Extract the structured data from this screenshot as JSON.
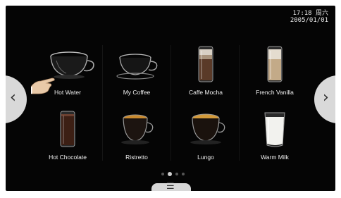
{
  "status": {
    "time": "17:18 周六",
    "date": "2005/01/01"
  },
  "drinks": [
    {
      "label": "Hot Water",
      "icon": "hot-water-cup-icon"
    },
    {
      "label": "My Coffee",
      "icon": "my-coffee-cup-icon"
    },
    {
      "label": "Caffe Mocha",
      "icon": "caffe-mocha-glass-icon"
    },
    {
      "label": "French Vanilla",
      "icon": "french-vanilla-glass-icon"
    },
    {
      "label": "Hot Chocolate",
      "icon": "hot-chocolate-glass-icon"
    },
    {
      "label": "Ristretto",
      "icon": "ristretto-cup-icon"
    },
    {
      "label": "Lungo",
      "icon": "lungo-cup-icon"
    },
    {
      "label": "Warm Milk",
      "icon": "warm-milk-glass-icon"
    }
  ],
  "nav": {
    "prev_icon": "chevron-left-icon",
    "next_icon": "chevron-right-icon",
    "menu_icon": "hamburger-menu-icon"
  },
  "pagination": {
    "pages": 4,
    "current": 2
  },
  "colors": {
    "background": "#050505",
    "text": "#f0f0f0",
    "nav_button": "#d9d9d9"
  }
}
